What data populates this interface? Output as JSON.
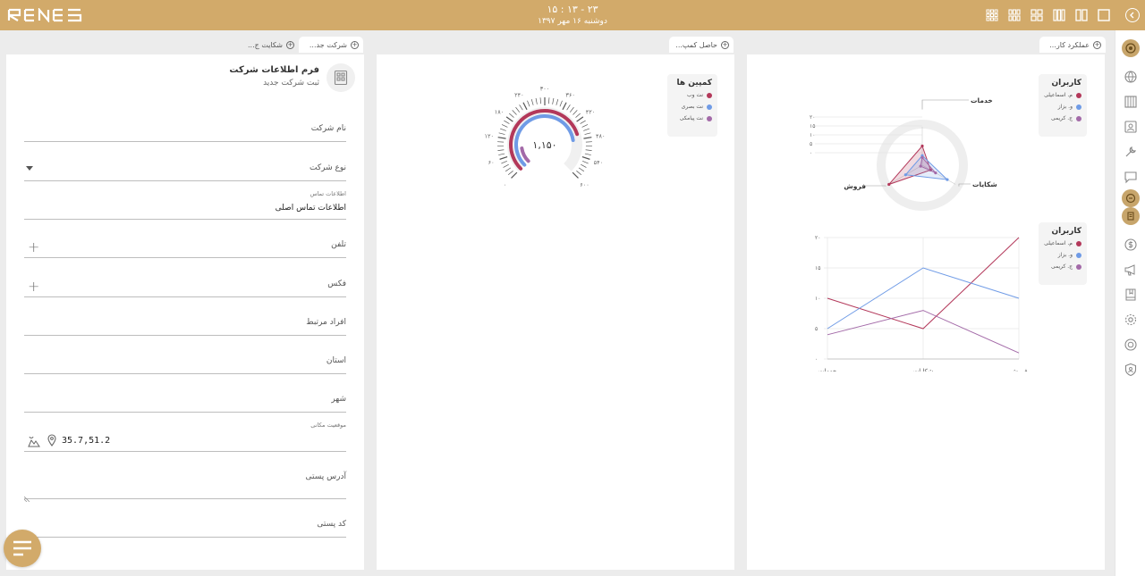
{
  "header": {
    "time": "۱۵ : ۱۳ - ۲۳",
    "date": "دوشنبه ۱۶ مهر ۱۳۹۷"
  },
  "tabs": {
    "form": "شرکت جد...",
    "complaints": "شکایت ج...",
    "campaign": "حاصل کمپ...",
    "performance": "عملکرد کار..."
  },
  "form": {
    "title": "فرم اطلاعات شرکت",
    "subtitle": "ثبت شرکت جدید",
    "fields": {
      "company_name": "نام شرکت",
      "company_type": "نوع شرکت",
      "contact_info_label": "اطلاعات تماس",
      "contact_info_value": "اطلاعات تماس اصلی",
      "phone": "تلفن",
      "fax": "فکس",
      "related_people": "افراد مرتبط",
      "province": "استان",
      "city": "شهر",
      "location_label": "موقعیت مکانی",
      "location_value": "35.7,51.2",
      "postal_address": "آدرس پستی",
      "postal_code": "کد پستی"
    }
  },
  "colors": {
    "brand": "#d2aa6a",
    "series1": "#b3385a",
    "series2": "#6f9be6",
    "series3": "#a36aa8"
  },
  "chart_data": [
    {
      "type": "gauge",
      "title": "کمپین ها",
      "center_label": "۱,۱۵۰",
      "scale_labels": [
        "۰",
        "۶۰",
        "۱۲۰",
        "۱۸۰",
        "۲۴۰",
        "۳۰۰",
        "۳۶۰",
        "۴۲۰",
        "۴۸۰",
        "۵۴۰",
        "۶۰۰"
      ],
      "range": [
        0,
        600
      ],
      "series": [
        {
          "name": "نت وب",
          "value": 460
        },
        {
          "name": "نت بصری",
          "value": 480
        },
        {
          "name": "نت پیامکی",
          "value": 80
        }
      ]
    },
    {
      "type": "radar",
      "title": "کاربران",
      "axes": [
        "خدمات",
        "شکایات",
        "فروش"
      ],
      "ticks": [
        "۰",
        "۵",
        "۱۰",
        "۱۵",
        "۲۰"
      ],
      "range": [
        0,
        20
      ],
      "series": [
        {
          "name": "م. اسماعیلی",
          "values": [
            10,
            5,
            20
          ]
        },
        {
          "name": "و. بزاز",
          "values": [
            5,
            15,
            10
          ]
        },
        {
          "name": "ج. کریمی",
          "values": [
            4,
            8,
            1
          ]
        }
      ]
    },
    {
      "type": "line",
      "title": "کاربران",
      "categories": [
        "خدمات",
        "شکایات",
        "فروش"
      ],
      "yticks": [
        "۰",
        "۵",
        "۱۰",
        "۱۵",
        "۲۰"
      ],
      "ylim": [
        0,
        20
      ],
      "grid": true,
      "series": [
        {
          "name": "م. اسماعیلی",
          "values": [
            10,
            5,
            20
          ]
        },
        {
          "name": "و. بزاز",
          "values": [
            5,
            15,
            10
          ]
        },
        {
          "name": "ج. کریمی",
          "values": [
            4,
            8,
            1
          ]
        }
      ]
    }
  ]
}
